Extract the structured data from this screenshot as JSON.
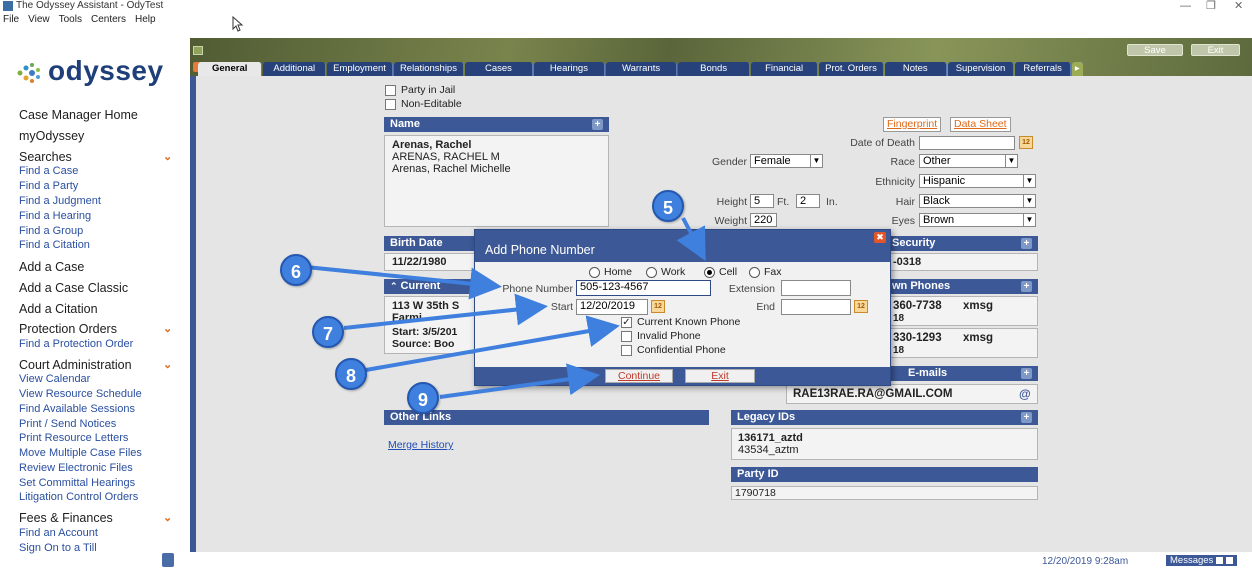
{
  "window": {
    "title": "The Odyssey Assistant - OdyTest",
    "minimize": "—",
    "restore": "❐",
    "close": "✕"
  },
  "menu": [
    "File",
    "View",
    "Tools",
    "Centers",
    "Help"
  ],
  "logo": {
    "text": "odyssey"
  },
  "sidebar": {
    "case_manager_home": "Case Manager Home",
    "my_odyssey": "myOdyssey",
    "searches": "Searches",
    "search_items": [
      "Find a Case",
      "Find a Party",
      "Find a Judgment",
      "Find a Hearing",
      "Find a Group",
      "Find a Citation"
    ],
    "add_case": "Add a Case",
    "add_case_classic": "Add a Case Classic",
    "add_citation": "Add a Citation",
    "protection_orders": "Protection Orders",
    "protection_items": [
      "Find a Protection Order"
    ],
    "court_admin": "Court Administration",
    "court_admin_items": [
      "View Calendar",
      "View Resource Schedule",
      "Find Available Sessions",
      "Print / Send Notices",
      "Print Resource Letters",
      "Move Multiple Case Files",
      "Review Electronic Files",
      "Set Committal Hearings",
      "Litigation Control Orders"
    ],
    "fees": "Fees & Finances",
    "fees_items": [
      "Find an Account",
      "Sign On to a Till"
    ]
  },
  "toolbar": {
    "save": "Save",
    "exit": "Exit"
  },
  "tabs": [
    "General",
    "Additional",
    "Employment",
    "Relationships",
    "Cases",
    "Hearings",
    "Warrants",
    "Bonds",
    "Financial",
    "Prot. Orders",
    "Notes",
    "Supervision",
    "Referrals"
  ],
  "general": {
    "party_in_jail": "Party in Jail",
    "non_editable": "Non-Editable",
    "name_header": "Name",
    "names": [
      "Arenas, Rachel",
      "ARENAS, RACHEL M",
      "Arenas, Rachel Michelle"
    ],
    "fingerprint": "Fingerprint",
    "data_sheet": "Data Sheet",
    "date_of_death_label": "Date of Death",
    "gender_label": "Gender",
    "gender": "Female",
    "race_label": "Race",
    "race": "Other",
    "ethnicity_label": "Ethnicity",
    "ethnicity": "Hispanic",
    "height_label": "Height",
    "height_ft": "5",
    "ft": "Ft.",
    "height_in": "2",
    "in": "In.",
    "hair_label": "Hair",
    "hair": "Black",
    "weight_label": "Weight",
    "weight": "220",
    "eyes_label": "Eyes",
    "eyes": "Brown",
    "birth_date_header": "Birth Date",
    "birth_date": "11/22/1980",
    "security_header": "Security",
    "security_value": "-0318",
    "current_header": "Current",
    "address_line": "113 W 35th S",
    "address_line2": "Farmi",
    "start_line": "Start: 3/5/201",
    "source_line": "Source: Boo",
    "phones_header": "wn Phones",
    "phone1": "360-7738",
    "phone1_tag": "xmsg",
    "phone1_suffix": "18",
    "phone2": "330-1293",
    "phone2_tag": "xmsg",
    "phone2_suffix": "18",
    "emails_header": "E-mails",
    "email": "RAE13RAE.RA@GMAIL.COM",
    "at_icon": "@",
    "other_links_header": "Other Links",
    "merge_history": "Merge History",
    "legacy_header": "Legacy IDs",
    "legacy_ids": [
      "136171_aztd",
      "43534_aztm"
    ],
    "party_id_header": "Party ID",
    "party_id": "1790718",
    "cal_glyph": "12",
    "plus_glyph": "+",
    "dropdown_glyph": "▼",
    "chevron_glyph": "⌃"
  },
  "dialog": {
    "title": "Add Phone Number",
    "close_glyph": "✖",
    "radio_options": [
      "Home",
      "Work",
      "Cell",
      "Fax"
    ],
    "selected": "Cell",
    "phone_label": "Phone Number",
    "phone_value": "505-123-4567",
    "extension_label": "Extension",
    "extension_value": "",
    "start_label": "Start",
    "start_value": "12/20/2019",
    "end_label": "End",
    "end_value": "",
    "current_known": "Current Known Phone",
    "current_known_checked": true,
    "invalid": "Invalid Phone",
    "confidential": "Confidential Phone",
    "check_glyph": "✓",
    "continue": "Continue",
    "exit": "Exit"
  },
  "callouts": [
    "5",
    "6",
    "7",
    "8",
    "9"
  ],
  "status": {
    "time": "12/20/2019 9:28am",
    "messages": "Messages"
  },
  "colors": {
    "accent": "#3c5896",
    "callout": "#3f7fdd",
    "link_orange": "#e06a1b",
    "olive": "#5d6a3d"
  }
}
